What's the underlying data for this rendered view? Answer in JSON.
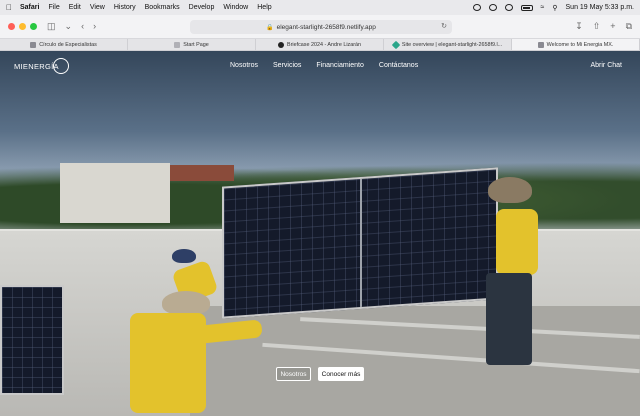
{
  "menubar": {
    "app": "Safari",
    "items": [
      "File",
      "Edit",
      "View",
      "History",
      "Bookmarks",
      "Develop",
      "Window",
      "Help"
    ],
    "datetime": "Sun 19 May  5:33 p.m."
  },
  "browser": {
    "url": "elegant-starlight-2658f9.netlify.app",
    "tabs": [
      {
        "label": "Círculo de Especialistas",
        "color": "#8a8a92"
      },
      {
        "label": "Start Page",
        "color": "#b0b0b6"
      },
      {
        "label": "Briefcase 2024 - Andre Lizarán",
        "color": "#222222"
      },
      {
        "label": "Site overview | elegant-starlight-2658f9.l...",
        "color": "#2aa58a"
      },
      {
        "label": "Welcome to Mi Energia MX.",
        "color": "#8a8a92"
      }
    ]
  },
  "site": {
    "logo_text": "MIENERGÍA",
    "nav": [
      "Nosotros",
      "Servicios",
      "Financiamiento",
      "Contáctanos"
    ],
    "chat": "Abrir Chat",
    "cta_primary": "Nosotros",
    "cta_secondary": "Conocer más"
  },
  "colors": {
    "accent_yellow": "#e3c22c",
    "panel_dark": "#141a2a",
    "traffic_red": "#ff5f57",
    "traffic_yellow": "#febc2e",
    "traffic_green": "#28c840"
  }
}
